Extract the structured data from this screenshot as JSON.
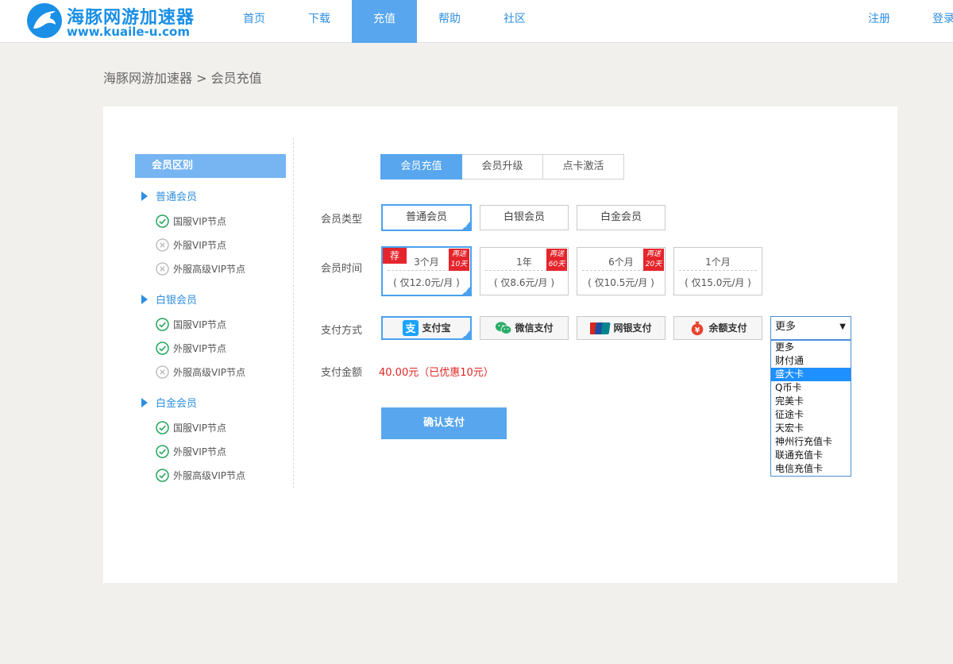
{
  "brand": {
    "name": "海豚网游加速器",
    "url": "www.kuaile-u.com"
  },
  "colors": {
    "accent": "#58a6ee",
    "link": "#2e8fe0",
    "price": "#e02424",
    "badge": "#e5252c",
    "check": "#23a55a"
  },
  "nav": {
    "items": [
      "首页",
      "下载",
      "充值",
      "帮助",
      "社区"
    ],
    "active": "充值"
  },
  "auth": {
    "register": "注册",
    "login": "登录"
  },
  "breadcrumb": {
    "home": "海豚网游加速器",
    "separator": ">",
    "current": "会员充值"
  },
  "sidebar": {
    "title": "会员区别",
    "groups": [
      {
        "name": "普通会员",
        "features": [
          {
            "label": "国服VIP节点",
            "included": true
          },
          {
            "label": "外服VIP节点",
            "included": false
          },
          {
            "label": "外服高级VIP节点",
            "included": false
          }
        ]
      },
      {
        "name": "白银会员",
        "features": [
          {
            "label": "国服VIP节点",
            "included": true
          },
          {
            "label": "外服VIP节点",
            "included": true
          },
          {
            "label": "外服高级VIP节点",
            "included": false
          }
        ]
      },
      {
        "name": "白金会员",
        "features": [
          {
            "label": "国服VIP节点",
            "included": true
          },
          {
            "label": "外服VIP节点",
            "included": true
          },
          {
            "label": "外服高级VIP节点",
            "included": true
          }
        ]
      }
    ]
  },
  "tabs": {
    "items": [
      "会员充值",
      "会员升级",
      "点卡激活"
    ],
    "active": "会员充值"
  },
  "form": {
    "member_type": {
      "label": "会员类型",
      "options": [
        "普通会员",
        "白银会员",
        "白金会员"
      ],
      "selected": "普通会员"
    },
    "duration": {
      "label": "会员时间",
      "recommend_badge": "荐",
      "options": [
        {
          "period": "3个月",
          "price": "( 仅12.0元/月 )",
          "bonus": [
            "再送",
            "10天"
          ],
          "recommended": true,
          "selected": true
        },
        {
          "period": "1年",
          "price": "( 仅8.6元/月 )",
          "bonus": [
            "再送",
            "60天"
          ],
          "recommended": false,
          "selected": false
        },
        {
          "period": "6个月",
          "price": "( 仅10.5元/月 )",
          "bonus": [
            "再送",
            "20天"
          ],
          "recommended": false,
          "selected": false
        },
        {
          "period": "1个月",
          "price": "( 仅15.0元/月 )",
          "bonus": null,
          "recommended": false,
          "selected": false
        }
      ]
    },
    "payment": {
      "label": "支付方式",
      "options": [
        {
          "label": "支付宝",
          "icon": "alipay-icon",
          "selected": true
        },
        {
          "label": "微信支付",
          "icon": "wechat-pay-icon",
          "selected": false
        },
        {
          "label": "网银支付",
          "icon": "unionpay-icon",
          "selected": false
        },
        {
          "label": "余额支付",
          "icon": "balance-icon",
          "selected": false
        }
      ],
      "more": {
        "value": "更多",
        "open": true,
        "options": [
          "更多",
          "财付通",
          "盛大卡",
          "Q币卡",
          "完美卡",
          "征途卡",
          "天宏卡",
          "神州行充值卡",
          "联通充值卡",
          "电信充值卡"
        ],
        "highlighted": "盛大卡"
      }
    },
    "amount": {
      "label": "支付金额",
      "value": "40.00元（已优惠10元）"
    },
    "submit": "确认支付"
  }
}
